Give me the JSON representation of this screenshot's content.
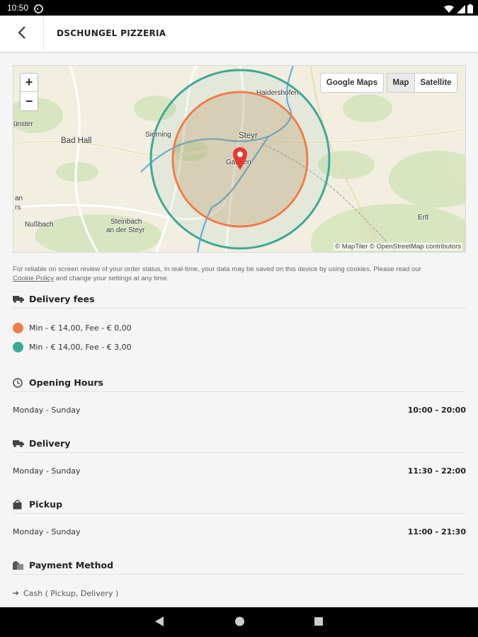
{
  "status_bar": {
    "time": "10:50"
  },
  "app_bar": {
    "title": "DSCHUNGEL PIZZERIA"
  },
  "map": {
    "buttons": {
      "google_maps": "Google Maps",
      "map": "Map",
      "satellite": "Satellite"
    },
    "zoom_in": "+",
    "zoom_out": "−",
    "attribution": "© MapTiler © OpenStreetMap contributors",
    "places": {
      "haidershofen": "Haidershofen",
      "steyr": "Steyr",
      "sierning": "Sierning",
      "bad_hall": "Bad Hall",
      "nunster": "ünster",
      "garsten": "Garsten",
      "steinbach_1": "Steinbach",
      "steinbach_2": "an der Steyr",
      "nussbach": "Nußbach",
      "ertl": "Ertl",
      "an": "an",
      "rs": "rs"
    },
    "colors": {
      "inner_zone": "#f07c47",
      "outer_zone": "#3ba996",
      "pin": "#e53935"
    }
  },
  "cookie_notice": {
    "text": "For reliable on screen review of your order status, in real-time, your data may be saved on this device by using cookies. Please read our",
    "link": "Cookie Policy",
    "text_after": "and change your settings at any time."
  },
  "delivery_fees": {
    "title": "Delivery fees",
    "icon": "delivery-truck-icon",
    "items": [
      {
        "label": "Min - € 14,00, Fee - € 0,00",
        "color": "#f07c47"
      },
      {
        "label": "Min - € 14,00, Fee - € 3,00",
        "color": "#3ba996"
      }
    ]
  },
  "opening_hours": {
    "title": "Opening Hours",
    "icon": "clock-icon",
    "days": "Monday - Sunday",
    "hours": "10:00 - 20:00"
  },
  "delivery": {
    "title": "Delivery",
    "icon": "delivery-truck-icon",
    "days": "Monday - Sunday",
    "hours": "11:30 - 22:00"
  },
  "pickup": {
    "title": "Pickup",
    "icon": "shopping-bag-icon",
    "days": "Monday - Sunday",
    "hours": "11:00 - 21:30"
  },
  "payment": {
    "title": "Payment Method",
    "icon": "payment-icon",
    "method": "Cash ( Pickup, Delivery )"
  }
}
